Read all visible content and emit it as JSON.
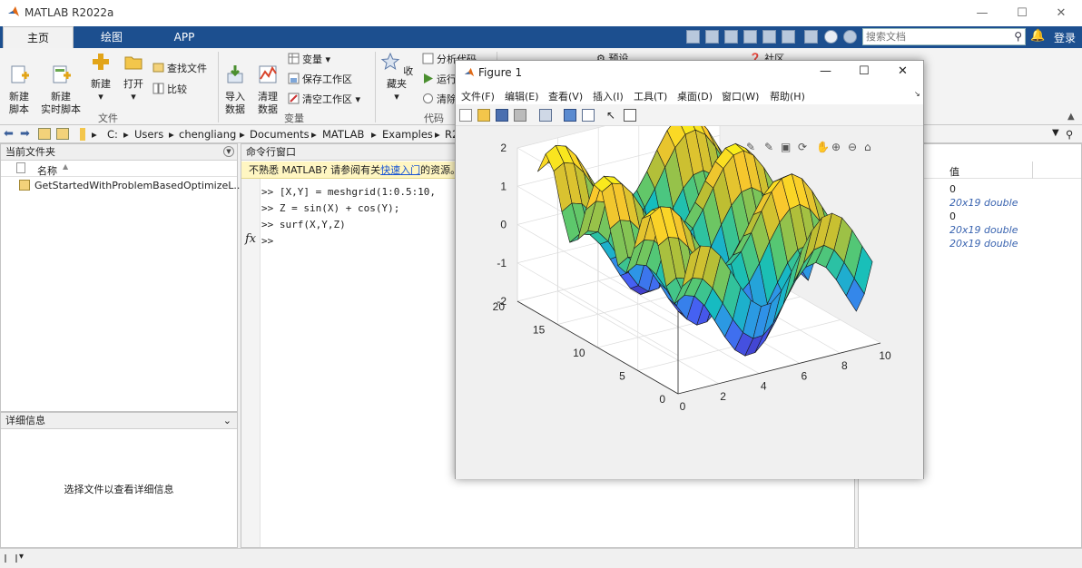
{
  "window": {
    "title": "MATLAB R2022a"
  },
  "ribbon_tabs": [
    {
      "label": "主页"
    },
    {
      "label": "绘图"
    },
    {
      "label": "APP"
    }
  ],
  "search": {
    "placeholder": "搜索文档"
  },
  "login_label": "登录",
  "ribbon": {
    "new_script": "新建\n脚本",
    "new_live_script": "新建\n实时脚本",
    "new": "新建",
    "open": "打开",
    "find_files": "查找文件",
    "compare": "比较",
    "file_group": "文件",
    "import_data": "导入\n数据",
    "clean_data": "清理\n数据",
    "variable": "变量",
    "save_workspace": "保存工作区",
    "clear_workspace": "清空工作区",
    "variable_group": "变量",
    "favorites": "收藏夹",
    "analyze_code": "分析代码",
    "run": "运行",
    "clear": "清除",
    "code_group": "代码",
    "preferences": "预设",
    "community": "社区"
  },
  "address": {
    "crumbs": [
      "C:",
      "Users",
      "chengliang",
      "Documents",
      "MATLAB",
      "Examples",
      "R2"
    ]
  },
  "current_folder": {
    "title": "当前文件夹",
    "name_header": "名称",
    "files": [
      "GetStartedWithProblemBasedOptimizeL..."
    ]
  },
  "details": {
    "title": "详细信息",
    "empty_text": "选择文件以查看详细信息"
  },
  "command_window": {
    "title": "命令行窗口",
    "notice_prefix": "不熟悉 MATLAB? 请参阅有关",
    "notice_link": "快速入门",
    "notice_suffix": "的资源。",
    "lines": [
      ">> [X,Y] = meshgrid(1:0.5:10,",
      ">> Z = sin(X) + cos(Y);",
      ">> surf(X,Y,Z)"
    ],
    "prompt": ">>",
    "fx": "fx"
  },
  "workspace": {
    "value_header": "值",
    "values": [
      "0",
      "20x19 double",
      "0",
      "20x19 double",
      "20x19 double"
    ]
  },
  "figure": {
    "title": "Figure 1",
    "menus": [
      "文件(F)",
      "编辑(E)",
      "查看(V)",
      "插入(I)",
      "工具(T)",
      "桌面(D)",
      "窗口(W)",
      "帮助(H)"
    ]
  },
  "chart_data": {
    "type": "surface",
    "function": "Z = sin(X) + cos(Y)",
    "x_range": [
      1,
      10
    ],
    "x_step": 0.5,
    "y_range": [
      1,
      20
    ],
    "x_ticks": [
      0,
      2,
      4,
      6,
      8,
      10
    ],
    "y_ticks": [
      0,
      5,
      10,
      15,
      20
    ],
    "z_ticks": [
      -2,
      -1,
      0,
      1,
      2
    ],
    "zlim": [
      -2,
      2
    ],
    "colormap": "parula",
    "grid": true,
    "title": "",
    "xlabel": "",
    "ylabel": "",
    "zlabel": ""
  },
  "colors": {
    "ribbon_blue": "#1c4f8f",
    "link": "#1a55d4",
    "italic_value": "#3a64b0"
  }
}
